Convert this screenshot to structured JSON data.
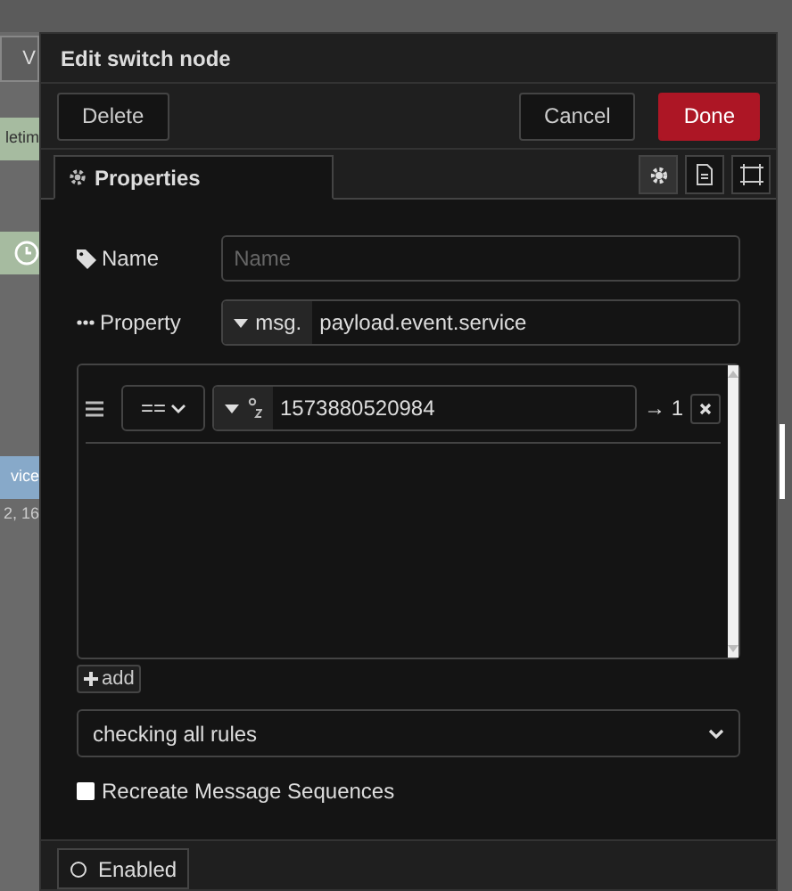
{
  "canvas": {
    "tab_label": "V",
    "nodes": [
      {
        "kind": "label",
        "label": "letim",
        "color": "#a6bba0"
      },
      {
        "kind": "clock",
        "color": "#a6bba0"
      },
      {
        "kind": "label",
        "label": "vice",
        "color": "#87a9c9"
      }
    ],
    "node_caption": "2, 16"
  },
  "dialog": {
    "title": "Edit switch node",
    "buttons": [
      {
        "label": "Delete",
        "kind": "secondary"
      },
      {
        "label": "Cancel",
        "kind": "secondary"
      },
      {
        "label": "Done",
        "kind": "primary"
      }
    ],
    "tabs": [
      {
        "label": "Properties",
        "selected": true
      }
    ],
    "side_tabs": [
      {
        "kind": "gear",
        "selected": true
      },
      {
        "kind": "document",
        "selected": false
      },
      {
        "kind": "frame",
        "selected": false
      }
    ],
    "name_field": {
      "label": "Name",
      "placeholder": "Name"
    },
    "property_field": {
      "label": "Property",
      "type": "msg.",
      "value": "payload.event.service"
    },
    "rules": [
      {
        "operator": "==",
        "value": "1573880520984",
        "output": "→ 1"
      }
    ],
    "add_button": "add",
    "mode": "checking all rules",
    "recreate": {
      "label": "Recreate Message Sequences",
      "checked": false
    },
    "footer": {
      "label": "Enabled"
    }
  }
}
